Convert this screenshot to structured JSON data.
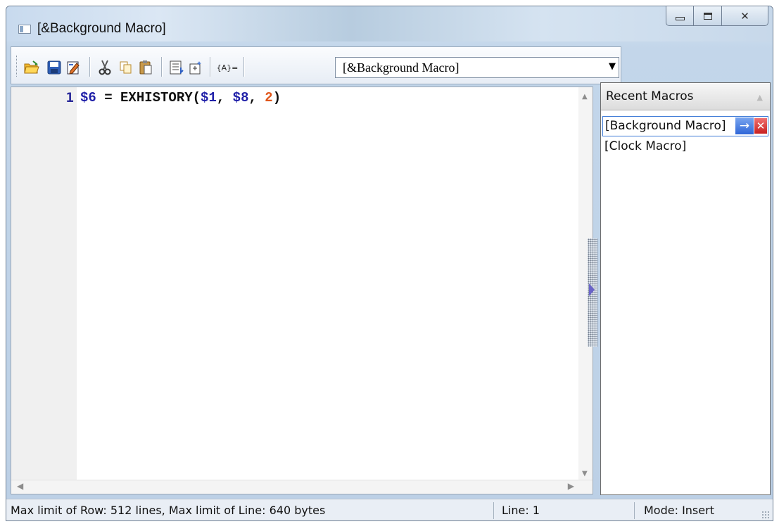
{
  "window": {
    "title": "[&Background Macro]",
    "controls": {
      "minimize": "minimize",
      "maximize": "maximize",
      "close": "close"
    }
  },
  "toolbar": {
    "icons": [
      "open-folder-icon",
      "save-icon",
      "edit-icon",
      "cut-icon",
      "copy-icon",
      "paste-icon",
      "insert-list-icon",
      "insert-image-icon",
      "insert-variable-icon"
    ],
    "insert_variable_label": "{A}=",
    "macro_select_value": "[&Background Macro]"
  },
  "editor": {
    "lines": [
      {
        "number": "1",
        "tokens": [
          {
            "text": "$6",
            "kind": "var"
          },
          {
            "text": " = EXHISTORY(",
            "kind": "op"
          },
          {
            "text": "$1",
            "kind": "var"
          },
          {
            "text": ", ",
            "kind": "op"
          },
          {
            "text": "$8",
            "kind": "var"
          },
          {
            "text": ", ",
            "kind": "op"
          },
          {
            "text": "2",
            "kind": "num"
          },
          {
            "text": ")",
            "kind": "op"
          }
        ]
      }
    ],
    "colors": {
      "variable": "#1f1fa8",
      "number": "#e0561a",
      "text": "#101010",
      "gutter": "#f0f0f0"
    }
  },
  "recent_macros": {
    "header": "Recent Macros",
    "items": [
      {
        "label": "[Background Macro]",
        "selected": true
      },
      {
        "label": "[Clock Macro]",
        "selected": false
      }
    ],
    "actions": {
      "go": "→",
      "delete": "✕"
    }
  },
  "statusbar": {
    "limits": "Max limit of Row: 512 lines, Max limit of Line: 640 bytes",
    "line": "Line: 1",
    "mode": "Mode: Insert"
  }
}
